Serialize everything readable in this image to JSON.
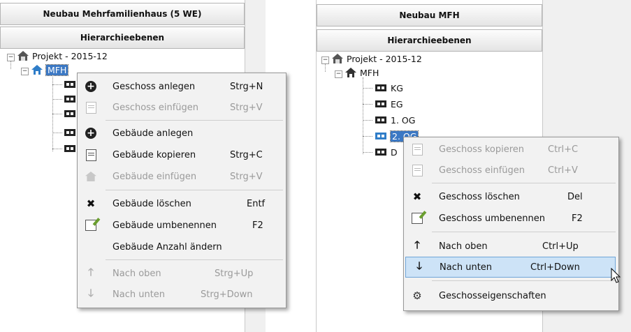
{
  "left": {
    "title": "Neubau Mehrfamilienhaus (5 WE)",
    "section": "Hierarchieebenen",
    "tree": {
      "root": "Projekt - 2015-12",
      "building": "MFH"
    },
    "menu": [
      {
        "label": "Geschoss anlegen",
        "shortcut": "Strg+N",
        "icon": "plus-circle-icon",
        "disabled": false
      },
      {
        "label": "Geschoss einfügen",
        "shortcut": "Strg+V",
        "icon": "paste-icon",
        "disabled": true
      },
      {
        "label": "Gebäude anlegen",
        "shortcut": "",
        "icon": "plus-circle-icon",
        "disabled": false
      },
      {
        "label": "Gebäude kopieren",
        "shortcut": "Strg+C",
        "icon": "copy-icon",
        "disabled": false
      },
      {
        "label": "Gebäude einfügen",
        "shortcut": "Strg+V",
        "icon": "house-icon",
        "disabled": true
      },
      {
        "label": "Gebäude löschen",
        "shortcut": "Entf",
        "icon": "delete-x-icon",
        "disabled": false
      },
      {
        "label": "Gebäude umbenennen",
        "shortcut": "F2",
        "icon": "rename-icon",
        "disabled": false
      },
      {
        "label": "Gebäude Anzahl ändern",
        "shortcut": "",
        "icon": "",
        "disabled": false
      },
      {
        "label": "Nach oben",
        "shortcut": "Strg+Up",
        "icon": "arrow-up-icon",
        "disabled": true
      },
      {
        "label": "Nach unten",
        "shortcut": "Strg+Down",
        "icon": "arrow-down-icon",
        "disabled": true
      }
    ]
  },
  "right": {
    "title": "Neubau MFH",
    "section": "Hierarchieebenen",
    "tree": {
      "root": "Projekt - 2015-12",
      "building": "MFH",
      "floors": [
        "KG",
        "EG",
        "1. OG",
        "2. OG",
        "D"
      ]
    },
    "menu": [
      {
        "label": "Geschoss kopieren",
        "shortcut": "Ctrl+C",
        "icon": "copy-icon",
        "disabled": true
      },
      {
        "label": "Geschoss einfügen",
        "shortcut": "Ctrl+V",
        "icon": "paste-icon",
        "disabled": true
      },
      {
        "label": "Geschoss löschen",
        "shortcut": "Del",
        "icon": "delete-x-icon",
        "disabled": false
      },
      {
        "label": "Geschoss umbenennen",
        "shortcut": "F2",
        "icon": "rename-icon",
        "disabled": false
      },
      {
        "label": "Nach oben",
        "shortcut": "Ctrl+Up",
        "icon": "arrow-up-icon",
        "disabled": false
      },
      {
        "label": "Nach unten",
        "shortcut": "Ctrl+Down",
        "icon": "arrow-down-icon",
        "disabled": false,
        "highlighted": true
      },
      {
        "label": "Geschosseigenschaften",
        "shortcut": "",
        "icon": "gear-icon",
        "disabled": false
      }
    ]
  }
}
